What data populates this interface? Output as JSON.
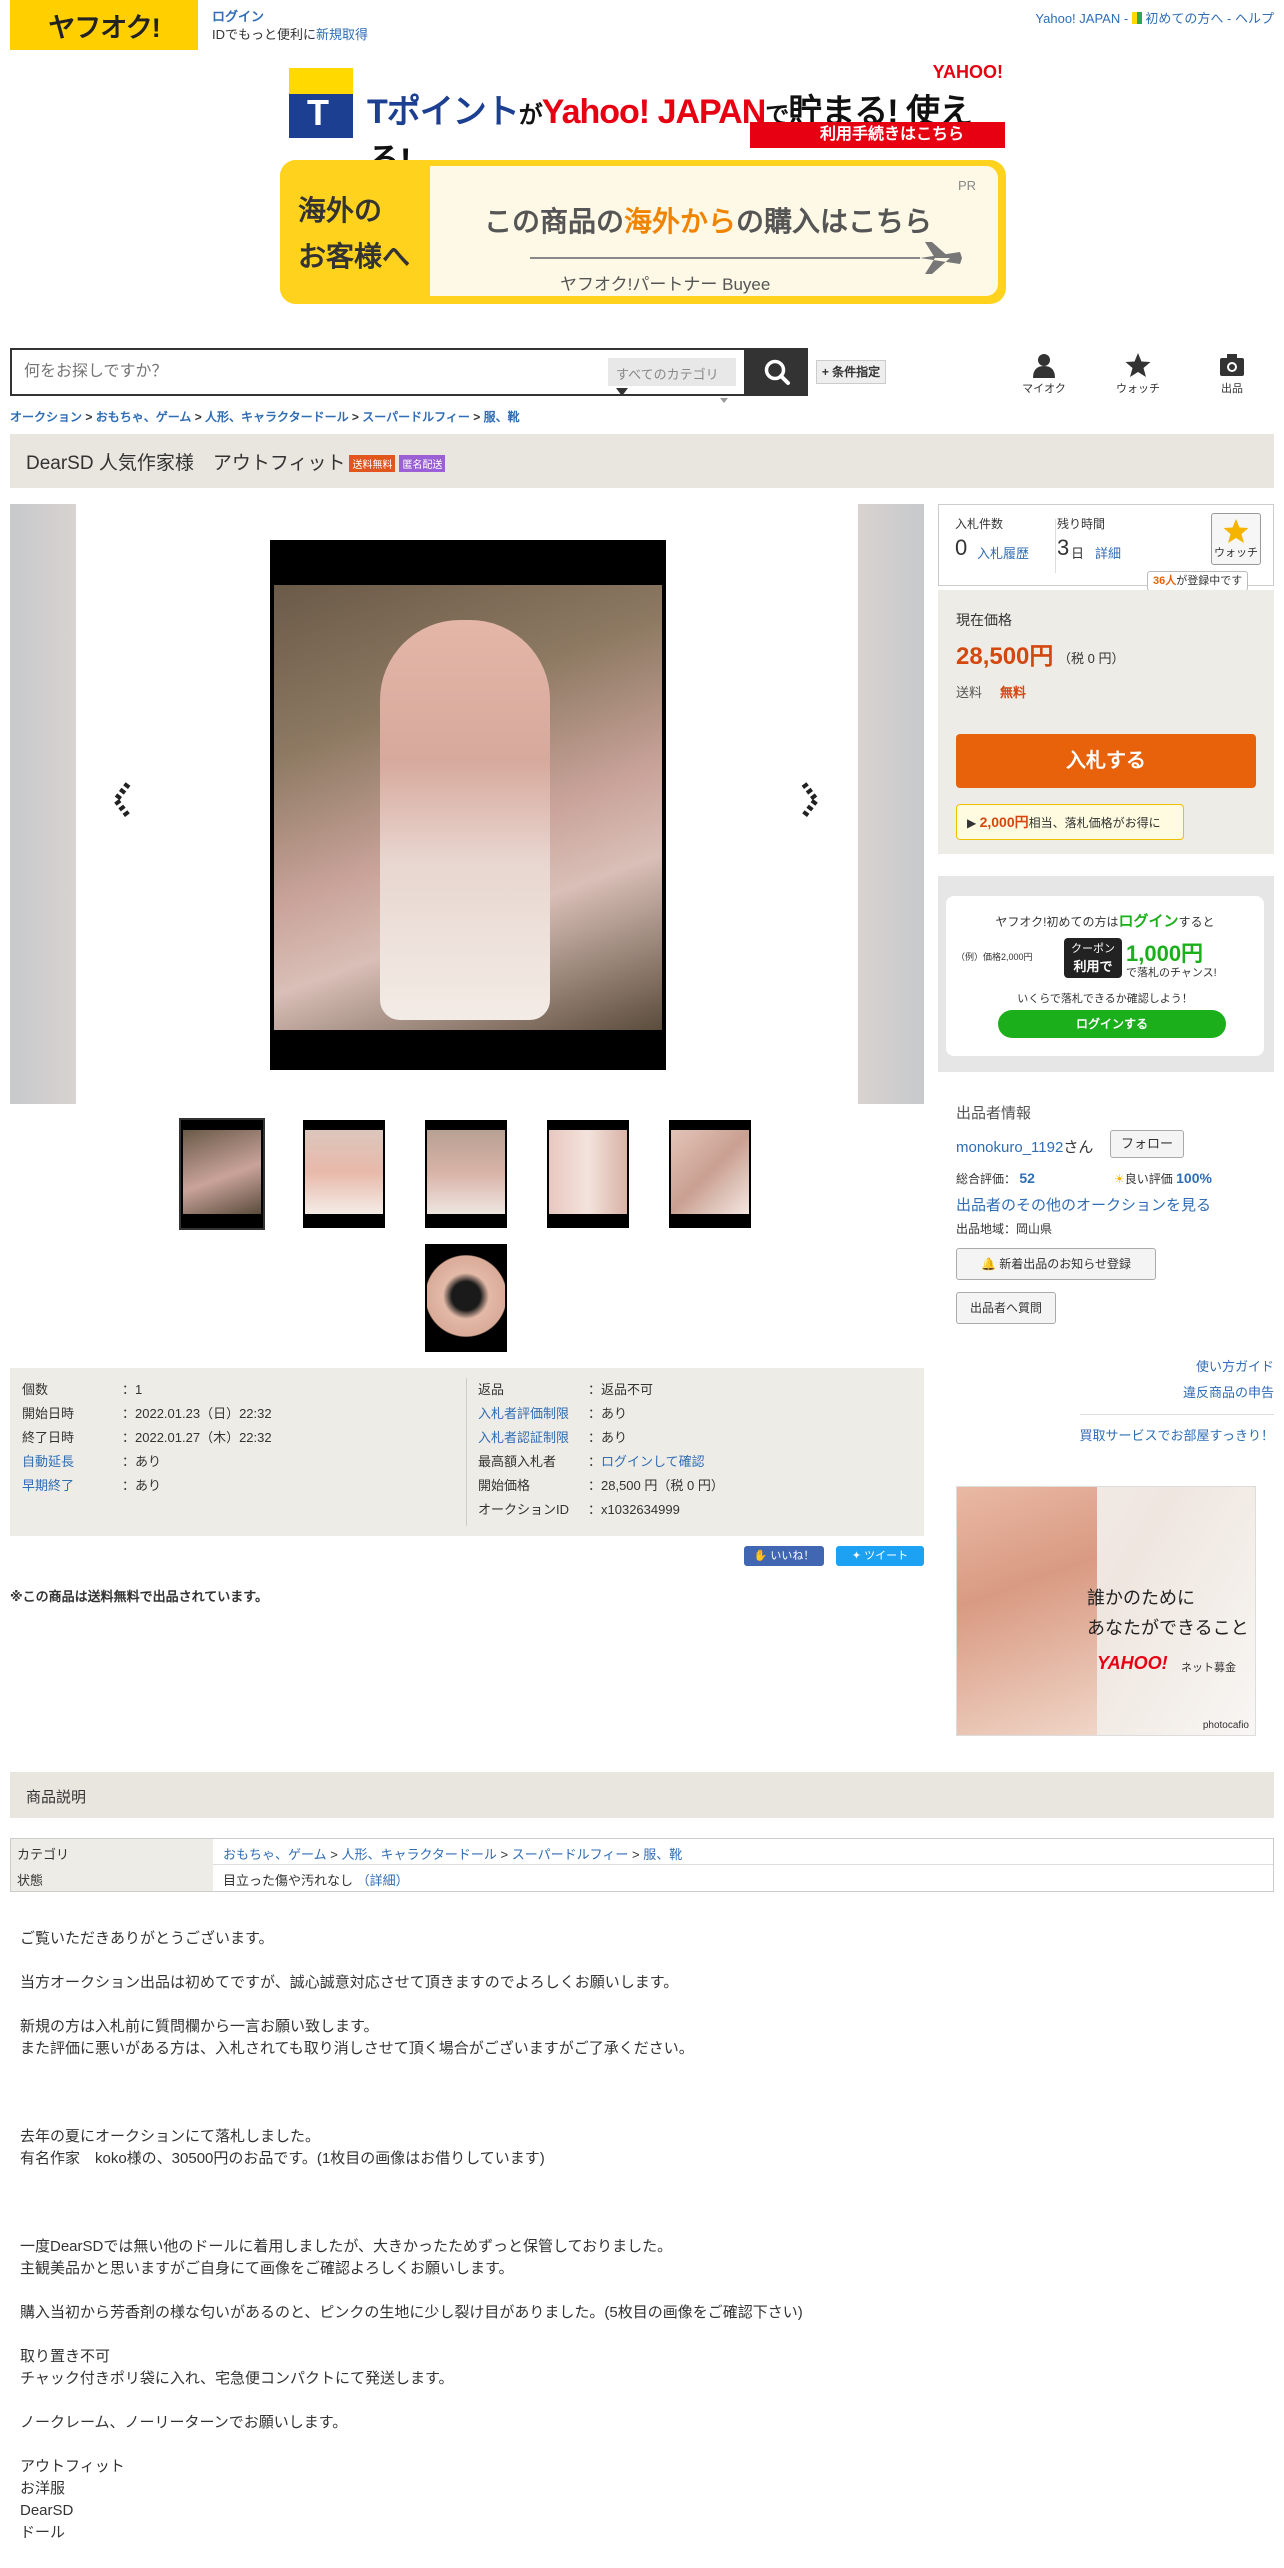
{
  "header": {
    "logo": "ヤフオク!",
    "login": "ログイン",
    "login_sub_prefix": "IDでもっと便利に",
    "register": "新規取得",
    "links": [
      "Yahoo! JAPAN",
      "初めての方へ",
      "ヘルプ"
    ]
  },
  "banners": {
    "tpoint_main_a": "Tポイント",
    "tpoint_main_b": "が",
    "tpoint_main_c": "Yahoo! JAPAN",
    "tpoint_main_d": "で",
    "tpoint_main_e": "貯まる! 使える!",
    "tpoint_logo": "YAHOO!",
    "tpoint_bar": "利用手続きはこちら",
    "overseas_left_1": "海外の",
    "overseas_left_2": "お客様へ",
    "overseas_msg_a": "この商品の",
    "overseas_msg_b": "海外から",
    "overseas_msg_c": "の購入はこちら",
    "overseas_partner": "ヤフオク!パートナー  Buyee",
    "pr": "PR"
  },
  "search": {
    "placeholder": "何をお探しですか？",
    "category": "すべてのカテゴリ",
    "condition": "+ 条件指定"
  },
  "nav_icons": [
    {
      "label": "マイオク",
      "icon": "person-icon"
    },
    {
      "label": "ウォッチ",
      "icon": "star-icon"
    },
    {
      "label": "出品",
      "icon": "camera-icon"
    }
  ],
  "breadcrumb": [
    "オークション",
    "おもちゃ、ゲーム",
    "人形、キャラクタードール",
    "スーパードルフィー",
    "服、靴"
  ],
  "item": {
    "title": "DearSD 人気作家様　アウトフィット",
    "badge_free_ship": "送料無料",
    "badge_anon": "匿名配送",
    "badge_colors": {
      "free_ship": "#e1551f",
      "anon": "#9a60d4"
    }
  },
  "details_left": [
    {
      "k": "個数",
      "v": "：1",
      "link": false
    },
    {
      "k": "開始日時",
      "v": "：2022.01.23（日）22:32",
      "link": false
    },
    {
      "k": "終了日時",
      "v": "：2022.01.27（木）22:32",
      "link": false
    },
    {
      "k": "自動延長",
      "v": "：あり",
      "link": true
    },
    {
      "k": "早期終了",
      "v": "：あり",
      "link": true
    }
  ],
  "details_right": [
    {
      "k": "返品",
      "v": "：返品不可",
      "link": false
    },
    {
      "k": "入札者評価制限",
      "v": "：あり",
      "link": true
    },
    {
      "k": "入札者認証制限",
      "v": "：あり",
      "link": true
    },
    {
      "k": "最高額入札者",
      "v": "：",
      "vlink": "ログインして確認",
      "link": false
    },
    {
      "k": "開始価格",
      "v": "：28,500 円（税 0 円）",
      "link": false
    },
    {
      "k": "オークションID",
      "v": "：x1032634999",
      "link": false
    }
  ],
  "social": {
    "like": "いいね！",
    "tweet": "ツイート"
  },
  "ship_note": "※この商品は送料無料で出品されています。",
  "bid": {
    "count_label": "入札件数",
    "count": "0",
    "history": "入札履歴",
    "time_label": "残り時間",
    "time_value": "3",
    "time_unit": "日",
    "time_detail": "詳細",
    "watch": "ウォッチ",
    "watch_count": "36人",
    "watch_suffix": "が登録中です",
    "price_label": "現在価格",
    "price": "28,500円",
    "tax": "（税 0 円）",
    "ship_label": "送料",
    "ship_value": "無料",
    "bid_button": "入札する",
    "point_amount": "2,000円",
    "point_text": "相当、落札価格がお得に"
  },
  "login_promo": {
    "line1_a": "ヤフオク!初めての方は",
    "line1_b": "ログイン",
    "line1_c": "すると",
    "example": "（例）価格2,000円",
    "coupon_a": "クーポン",
    "coupon_b": "利用で",
    "amount": "1,000円",
    "chance": "で落札のチャンス!",
    "line3": "いくらで落札できるか確認しよう！",
    "button": "ログインする"
  },
  "seller": {
    "heading": "出品者情報",
    "name": "monokuro_1192",
    "san": "さん",
    "follow": "フォロー",
    "rating_label": "総合評価：",
    "rating": "52",
    "good_label": "良い評価",
    "good_pct": "100%",
    "other_auctions": "出品者のその他のオークションを見る",
    "region": "出品地域：岡山県",
    "notify": "新着出品のお知らせ登録",
    "question": "出品者へ質問"
  },
  "right_links": [
    "使い方ガイド",
    "違反商品の申告",
    "買取サービスでお部屋すっきり！"
  ],
  "ad": {
    "line1": "誰かのために",
    "line2": "あなたができること",
    "brand": "YAHOO!",
    "brand_sub": "ネット募金",
    "credit": "photocafio"
  },
  "description": {
    "heading": "商品説明",
    "category_label": "カテゴリ",
    "category_path": [
      "おもちゃ、ゲーム",
      "人形、キャラクタードール",
      "スーパードルフィー",
      "服、靴"
    ],
    "condition_label": "状態",
    "condition": "目立った傷や汚れなし",
    "condition_detail": "（詳細）",
    "paragraphs": [
      "ご覧いただきありがとうございます。",
      "当方オークション出品は初めてですが、誠心誠意対応させて頂きますのでよろしくお願いします。",
      "新規の方は入札前に質問欄から一言お願い致します。\nまた評価に悪いがある方は、入札されても取り消しさせて頂く場合がございますがご了承ください。",
      "",
      "去年の夏にオークションにて落札しました。\n有名作家　koko様の、30500円のお品です。(1枚目の画像はお借りしています)",
      "",
      "一度DearSDでは無い他のドールに着用しましたが、大きかったためずっと保管しておりました。\n主観美品かと思いますがご自身にて画像をご確認よろしくお願いします。",
      "購入当初から芳香剤の様な匂いがあるのと、ピンクの生地に少し裂け目がありました。(5枚目の画像をご確認下さい)",
      "取り置き不可\nチャック付きポリ袋に入れ、宅急便コンパクトにて発送します。",
      "",
      "ノークレーム、ノーリーターンでお願いします。",
      "",
      "アウトフィット\nお洋服\nDearSD\nドール"
    ]
  }
}
